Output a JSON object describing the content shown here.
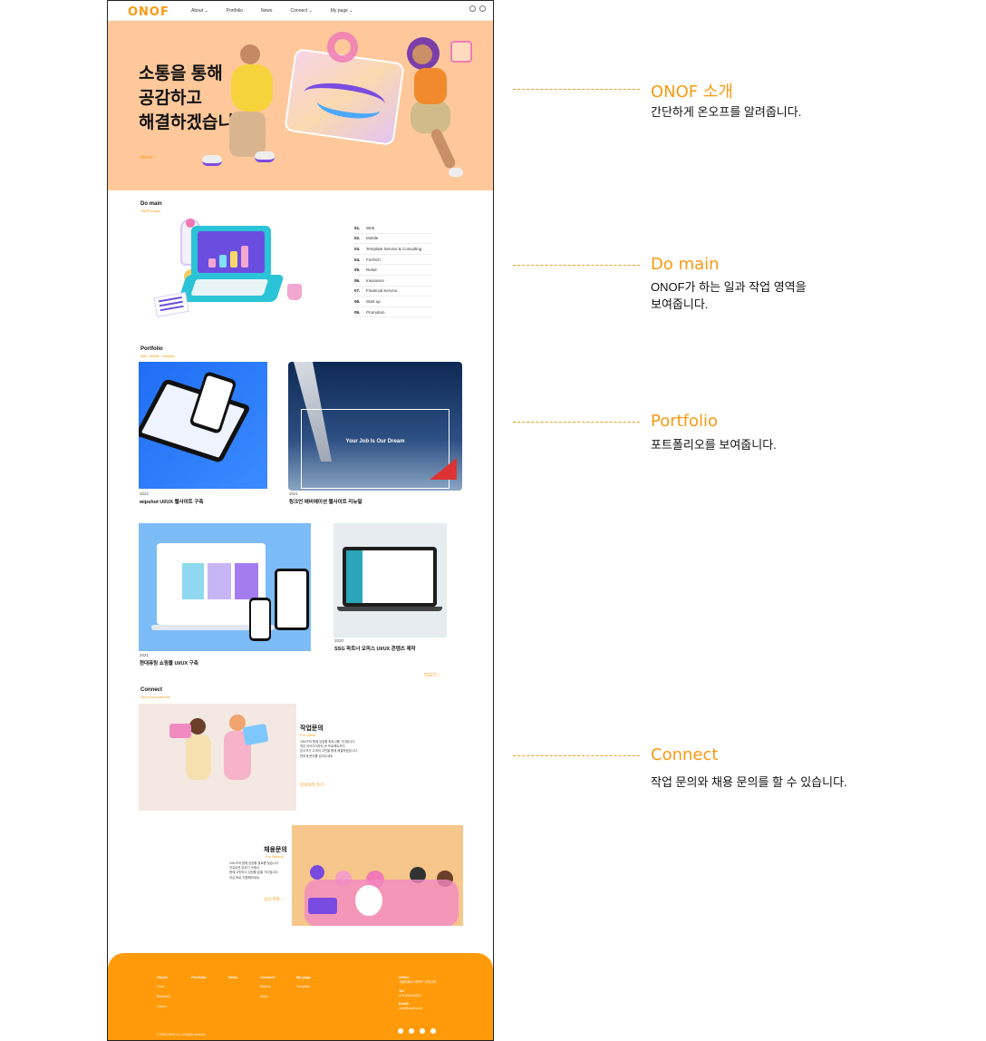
{
  "header": {
    "logo": "ONOF",
    "nav": [
      "About ⌄",
      "Portfolio",
      "News",
      "Connect ⌄",
      "My page ⌄"
    ],
    "icons": [
      "globe-icon",
      "user-icon"
    ]
  },
  "hero": {
    "title_lines": [
      "소통을 통해",
      "공감하고",
      "해결하겠습니다."
    ],
    "link": "About"
  },
  "domain": {
    "title": "Do main",
    "subtitle": "ONOF's major",
    "items": [
      {
        "num": "01.",
        "label": "Web"
      },
      {
        "num": "02.",
        "label": "Mobile"
      },
      {
        "num": "03.",
        "label": "Template Service & Consulting"
      },
      {
        "num": "04.",
        "label": "FinTech"
      },
      {
        "num": "05.",
        "label": "Retail"
      },
      {
        "num": "06.",
        "label": "Insurance"
      },
      {
        "num": "07.",
        "label": "Financial Service"
      },
      {
        "num": "08.",
        "label": "Start up"
      },
      {
        "num": "09.",
        "label": "Promotion"
      }
    ]
  },
  "portfolio": {
    "title": "Portfolio",
    "subtitle": "Web · Mobile · Template",
    "items": [
      {
        "year": "2022",
        "name": "wipshot UI/UX 웹사이트 구축"
      },
      {
        "year": "2021",
        "name": "링크언 에비에이션 웹사이트 리뉴얼",
        "image_text": "Your Job Is Our Dream"
      },
      {
        "year": "2021",
        "name": "현대퓨링 쇼핑몰 UI/UX 구축"
      },
      {
        "year": "2020",
        "name": "SSG 파트너 오피스 UI/UX 콘텐츠 제작"
      }
    ],
    "more": "더보기"
  },
  "connect": {
    "title": "Connect",
    "subtitle": "Get in touch with me!",
    "work": {
      "title": "작업문의",
      "en": "For Client",
      "lines": [
        "ONOF와 함께 성장할 파트너를 기다립니다.",
        "작은 아이디어부터 큰 프로젝트까지",
        "온오프가 고객의 고민을 함께 해결하겠습니다.",
        "편하게 문의를 남겨주세요."
      ],
      "button": "문의하러 가기"
    },
    "recruit": {
      "title": "채용문의",
      "en": "For Recruit",
      "lines": [
        "ONOF와 함께 성장할 동료를 찾습니다.",
        "자유로운 분위기 속에서",
        "함께 고민하고 성장할 분을 기다립니다.",
        "지금 바로 지원해보세요."
      ],
      "button": "입사 지원"
    }
  },
  "footer": {
    "cols": [
      {
        "head": "About",
        "links": [
          "Onof",
          "Business",
          "Career"
        ]
      },
      {
        "head": "Portfolio",
        "links": []
      },
      {
        "head": "News",
        "links": []
      },
      {
        "head": "Connect",
        "links": [
          "Recruit",
          "Work"
        ]
      },
      {
        "head": "My page",
        "links": [
          "Template"
        ]
      }
    ],
    "office_head": "Office.",
    "office": "서울특별시 마포구 성미산로",
    "tel_head": "Tel.",
    "tel": "070-0000-0000",
    "email_head": "Email.",
    "email": "onof@onof.co.kr",
    "copyright": "© 2022 ONOF Co., All rights reserved",
    "social": [
      "twitter-icon",
      "instagram-icon",
      "facebook-icon",
      "youtube-icon"
    ]
  },
  "annotations": [
    {
      "title": "ONOF 소개",
      "desc": [
        "간단하게 온오프를 알려줍니다."
      ]
    },
    {
      "title": "Do main",
      "desc": [
        "ONOF가 하는 일과 작업 영역을",
        "보여줍니다."
      ]
    },
    {
      "title": "Portfolio",
      "desc": [
        "포트폴리오를 보여줍니다."
      ]
    },
    {
      "title": "Connect",
      "desc": [
        "작업 문의와 채용 문의를 할 수 있습니다."
      ]
    }
  ],
  "colors": {
    "accent": "#f79a13",
    "hero_bg": "#fec89b",
    "footer_bg": "#ff9a0a"
  }
}
